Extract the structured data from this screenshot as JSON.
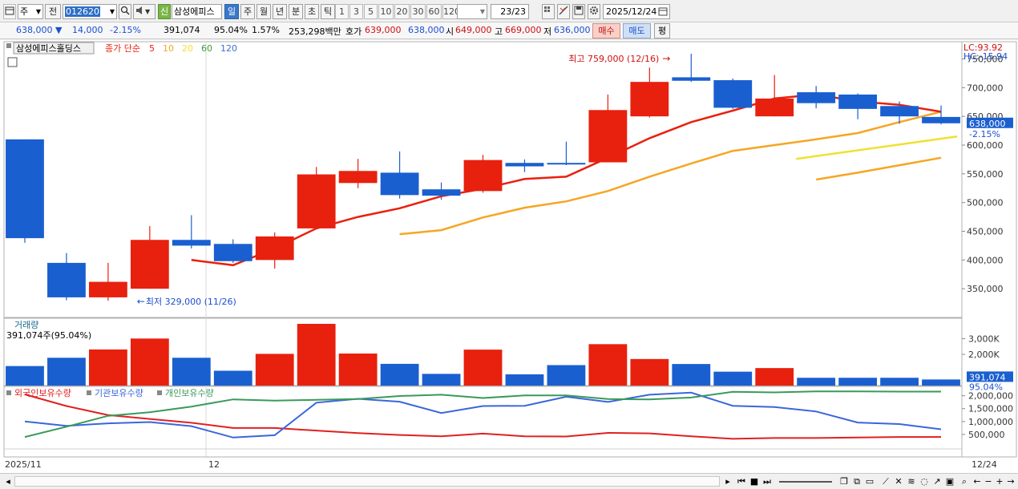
{
  "toolbar": {
    "period_select": "주",
    "prev_btn": "전",
    "code": "012620",
    "name": "삼성에피스",
    "new_badge": "신",
    "periods": [
      "일",
      "주",
      "월",
      "년",
      "분",
      "초",
      "틱"
    ],
    "active_period": "일",
    "minute_opts": [
      "1",
      "3",
      "5",
      "10",
      "20",
      "30",
      "60",
      "120"
    ],
    "page_count": "23/23",
    "date": "2025/12/24"
  },
  "quote": {
    "price": "638,000",
    "change": "14,000",
    "change_pct": "-2.15%",
    "volume": "391,074",
    "vol_ratio": "95.04%",
    "turnover": "1.57%",
    "amount": "253,298백만",
    "ask_label": "호가",
    "ask": "639,000",
    "bid": "638,000",
    "open_label": "시",
    "open": "649,000",
    "high_label": "고",
    "high": "669,000",
    "low_label": "저",
    "low": "636,000",
    "buy": "매수",
    "sell": "매도",
    "eval": "평"
  },
  "main_legend": {
    "name": "삼성에피스홀딩스",
    "ma_label": "종가 단순",
    "ma_periods": [
      "5",
      "10",
      "20",
      "60",
      "120"
    ],
    "ma_colors": [
      "#e8200e",
      "#f5a623",
      "#f0e030",
      "#3a9a3a",
      "#3b6fd1"
    ]
  },
  "right_info": {
    "lc": "LC:93.92",
    "hc": "HC:-15.94",
    "price_tag": "638,000",
    "pct_tag": "-2.15%",
    "vol_tag": "391,074",
    "vol_pct_tag": "95.04%"
  },
  "annotations": {
    "high": "최고 759,000 (12/16)",
    "low": "최저 329,000 (11/26)"
  },
  "volume_legend": {
    "title": "거래량",
    "value": "391,074주(95.04%)"
  },
  "holding_legend": {
    "foreign": "외국인보유수량",
    "inst": "기관보유수량",
    "retail": "개인보유수량"
  },
  "x_labels": {
    "left": "2025/11",
    "mid": "12",
    "right": "12/24"
  },
  "chart_data": [
    {
      "type": "candlestick",
      "y_ticks": [
        350000,
        400000,
        450000,
        500000,
        550000,
        600000,
        650000,
        700000,
        750000
      ],
      "y_tick_labels": [
        "350,000",
        "400,000",
        "450,000",
        "500,000",
        "550,000",
        "600,000",
        "650,000",
        "700,000",
        "750,000"
      ],
      "ylim": [
        300000,
        780000
      ],
      "candles": [
        {
          "o": 610000,
          "h": 610000,
          "l": 430000,
          "c": 438000
        },
        {
          "o": 395000,
          "h": 412000,
          "l": 330000,
          "c": 335000
        },
        {
          "o": 335000,
          "h": 395000,
          "l": 329000,
          "c": 362000
        },
        {
          "o": 350000,
          "h": 459000,
          "l": 350000,
          "c": 435000
        },
        {
          "o": 435000,
          "h": 478000,
          "l": 420000,
          "c": 425000
        },
        {
          "o": 428000,
          "h": 436000,
          "l": 395000,
          "c": 398000
        },
        {
          "o": 400000,
          "h": 448000,
          "l": 385000,
          "c": 441000
        },
        {
          "o": 455000,
          "h": 562000,
          "l": 455000,
          "c": 549000
        },
        {
          "o": 534000,
          "h": 576000,
          "l": 525000,
          "c": 555000
        },
        {
          "o": 552000,
          "h": 589000,
          "l": 507000,
          "c": 513000
        },
        {
          "o": 523000,
          "h": 535000,
          "l": 505000,
          "c": 512000
        },
        {
          "o": 520000,
          "h": 583000,
          "l": 517000,
          "c": 574000
        },
        {
          "o": 569000,
          "h": 575000,
          "l": 553000,
          "c": 563000
        },
        {
          "o": 569000,
          "h": 606000,
          "l": 565000,
          "c": 567000
        },
        {
          "o": 570000,
          "h": 688000,
          "l": 570000,
          "c": 661000
        },
        {
          "o": 650000,
          "h": 735000,
          "l": 648000,
          "c": 710000
        },
        {
          "o": 718000,
          "h": 759000,
          "l": 710000,
          "c": 712000
        },
        {
          "o": 713000,
          "h": 716000,
          "l": 663000,
          "c": 665000
        },
        {
          "o": 650000,
          "h": 722000,
          "l": 650000,
          "c": 681000
        },
        {
          "o": 692000,
          "h": 703000,
          "l": 664000,
          "c": 673000
        },
        {
          "o": 688000,
          "h": 690000,
          "l": 645000,
          "c": 663000
        },
        {
          "o": 668000,
          "h": 676000,
          "l": 637000,
          "c": 650000
        },
        {
          "o": 649000,
          "h": 669000,
          "l": 636000,
          "c": 638000
        }
      ],
      "ma5": [
        null,
        null,
        null,
        null,
        400000,
        391000,
        420000,
        455000,
        475000,
        490000,
        511000,
        524000,
        541000,
        545000,
        578000,
        612000,
        640000,
        660000,
        681000,
        688000,
        676000,
        670000,
        658000
      ],
      "ma10": [
        null,
        null,
        null,
        null,
        null,
        null,
        null,
        null,
        null,
        445000,
        452000,
        474000,
        491000,
        502000,
        520000,
        545000,
        568000,
        590000,
        600000,
        610000,
        621000,
        640000,
        658000
      ],
      "ma20": [
        null,
        null,
        null,
        null,
        null,
        null,
        null,
        null,
        null,
        null,
        null,
        null,
        null,
        null,
        null,
        null,
        null,
        null,
        null,
        540000,
        552000,
        565000,
        578000
      ]
    },
    {
      "type": "bar",
      "title": "거래량",
      "y_tick_labels": [
        "2,000K",
        "3,000K"
      ],
      "ylim": [
        0,
        4000000
      ],
      "values": [
        1250000,
        1780000,
        2310000,
        3010000,
        1780000,
        950000,
        2030000,
        3950000,
        2050000,
        1390000,
        750000,
        2300000,
        720000,
        1310000,
        2650000,
        1700000,
        1380000,
        890000,
        1120000,
        500000,
        500000,
        500000,
        391074
      ],
      "colors": [
        "blue",
        "blue",
        "red",
        "red",
        "blue",
        "blue",
        "red",
        "red",
        "red",
        "blue",
        "blue",
        "red",
        "blue",
        "blue",
        "red",
        "red",
        "blue",
        "blue",
        "red",
        "blue",
        "blue",
        "blue",
        "blue"
      ]
    },
    {
      "type": "line",
      "y_tick_labels": [
        "500,000",
        "1,000,000",
        "1,500,000",
        "2,000,000"
      ],
      "ylim": [
        0,
        2300000
      ],
      "series": [
        {
          "name": "외국인보유수량",
          "color": "#e02020",
          "values": [
            2050000,
            1600000,
            1250000,
            1100000,
            950000,
            750000,
            750000,
            650000,
            550000,
            480000,
            430000,
            530000,
            430000,
            420000,
            560000,
            540000,
            430000,
            330000,
            360000,
            360000,
            380000,
            400000,
            400000
          ]
        },
        {
          "name": "기관보유수량",
          "color": "#3a66dc",
          "values": [
            1000000,
            830000,
            930000,
            980000,
            820000,
            380000,
            470000,
            1730000,
            1880000,
            1770000,
            1330000,
            1600000,
            1610000,
            1960000,
            1760000,
            2040000,
            2120000,
            1610000,
            1560000,
            1390000,
            960000,
            900000,
            700000
          ]
        },
        {
          "name": "개인보유수량",
          "color": "#3a9a5a",
          "values": [
            400000,
            800000,
            1220000,
            1360000,
            1580000,
            1860000,
            1810000,
            1840000,
            1870000,
            1990000,
            2040000,
            1910000,
            2010000,
            2010000,
            1870000,
            1860000,
            1930000,
            2150000,
            2130000,
            2170000,
            2170000,
            2160000,
            2160000
          ]
        }
      ]
    }
  ]
}
